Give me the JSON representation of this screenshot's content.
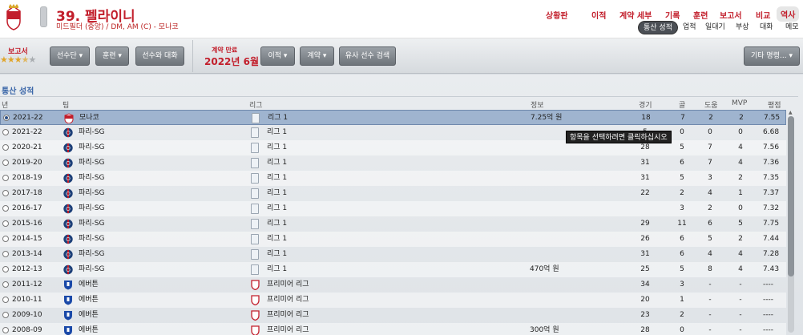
{
  "header": {
    "player_title": "39. 펠라이니",
    "player_subtitle": "미드필더 (중앙) / DM, AM (C) - 모나코",
    "nav": [
      "상황판",
      "이적",
      "계약 세부",
      "기록",
      "훈련",
      "보고서",
      "비교",
      "역사"
    ],
    "active_nav": "역사",
    "sub_tabs": [
      "통산 성적",
      "업적",
      "일대기",
      "부상",
      "대화",
      "메모"
    ],
    "active_sub_tab": "통산 성적"
  },
  "toolbar": {
    "report_label": "보고서",
    "stars_filled": 3.5,
    "stars_total": 5,
    "buttons": {
      "squad": "선수단 ▾",
      "training": "훈련 ▾",
      "talk": "선수와 대화",
      "transfer": "이적 ▾",
      "contract": "계약 ▾",
      "similar": "유사 선수 검색",
      "other": "기타 명령... ▾"
    },
    "contract_label": "계약 만료",
    "contract_value": "2022년 6월"
  },
  "section": {
    "title": "통산 성적",
    "columns": {
      "year": "년",
      "team": "팀",
      "league": "리그",
      "fee": "정보",
      "apps": "경기",
      "goals": "골",
      "assists": "도움",
      "mvp": "MVP",
      "rating": "평점"
    }
  },
  "rows": [
    {
      "year": "2021-22",
      "team": "모나코",
      "league": "리그 1",
      "fee": "7.25억 원",
      "apps": "18",
      "goals": "7",
      "assists": "2",
      "mvp": "2",
      "rating": "7.55",
      "badge": "monaco"
    },
    {
      "year": "2021-22",
      "team": "파리-SG",
      "league": "리그 1",
      "fee": "",
      "apps": "5",
      "goals": "0",
      "assists": "0",
      "mvp": "0",
      "rating": "6.68",
      "badge": "psg"
    },
    {
      "year": "2020-21",
      "team": "파리-SG",
      "league": "리그 1",
      "fee": "",
      "apps": "28",
      "goals": "5",
      "assists": "7",
      "mvp": "4",
      "rating": "7.56",
      "badge": "psg"
    },
    {
      "year": "2019-20",
      "team": "파리-SG",
      "league": "리그 1",
      "fee": "",
      "apps": "31",
      "goals": "6",
      "assists": "7",
      "mvp": "4",
      "rating": "7.36",
      "badge": "psg"
    },
    {
      "year": "2018-19",
      "team": "파리-SG",
      "league": "리그 1",
      "fee": "",
      "apps": "31",
      "goals": "5",
      "assists": "3",
      "mvp": "2",
      "rating": "7.35",
      "badge": "psg"
    },
    {
      "year": "2017-18",
      "team": "파리-SG",
      "league": "리그 1",
      "fee": "",
      "apps": "22",
      "goals": "2",
      "assists": "4",
      "mvp": "1",
      "rating": "7.37",
      "badge": "psg"
    },
    {
      "year": "2016-17",
      "team": "파리-SG",
      "league": "리그 1",
      "fee": "",
      "apps": "",
      "goals": "3",
      "assists": "2",
      "mvp": "0",
      "rating": "7.32",
      "badge": "psg"
    },
    {
      "year": "2015-16",
      "team": "파리-SG",
      "league": "리그 1",
      "fee": "",
      "apps": "29",
      "goals": "11",
      "assists": "6",
      "mvp": "5",
      "rating": "7.75",
      "badge": "psg"
    },
    {
      "year": "2014-15",
      "team": "파리-SG",
      "league": "리그 1",
      "fee": "",
      "apps": "26",
      "goals": "6",
      "assists": "5",
      "mvp": "2",
      "rating": "7.44",
      "badge": "psg"
    },
    {
      "year": "2013-14",
      "team": "파리-SG",
      "league": "리그 1",
      "fee": "",
      "apps": "31",
      "goals": "6",
      "assists": "4",
      "mvp": "4",
      "rating": "7.28",
      "badge": "psg"
    },
    {
      "year": "2012-13",
      "team": "파리-SG",
      "league": "리그 1",
      "fee": "470억 원",
      "apps": "25",
      "goals": "5",
      "assists": "8",
      "mvp": "4",
      "rating": "7.43",
      "badge": "psg"
    },
    {
      "year": "2011-12",
      "team": "에버튼",
      "league": "프리미어 리그",
      "fee": "",
      "apps": "34",
      "goals": "3",
      "assists": "-",
      "mvp": "-",
      "rating": "----",
      "badge": "everton"
    },
    {
      "year": "2010-11",
      "team": "에버튼",
      "league": "프리미어 리그",
      "fee": "",
      "apps": "20",
      "goals": "1",
      "assists": "-",
      "mvp": "-",
      "rating": "----",
      "badge": "everton"
    },
    {
      "year": "2009-10",
      "team": "에버튼",
      "league": "프리미어 리그",
      "fee": "",
      "apps": "23",
      "goals": "2",
      "assists": "-",
      "mvp": "-",
      "rating": "----",
      "badge": "everton"
    },
    {
      "year": "2008-09",
      "team": "에버튼",
      "league": "프리미어 리그",
      "fee": "300억 원",
      "apps": "28",
      "goals": "0",
      "assists": "-",
      "mvp": "-",
      "rating": "----",
      "badge": "everton"
    }
  ],
  "tooltip": "항목을 선택하려면 클릭하십시오",
  "colors": {
    "accent_red": "#c21e2b",
    "section_blue": "#3a66a8",
    "selected_row": "#9fb4cf",
    "psg_blue": "#1c3f78",
    "everton_blue": "#1a49a8"
  }
}
